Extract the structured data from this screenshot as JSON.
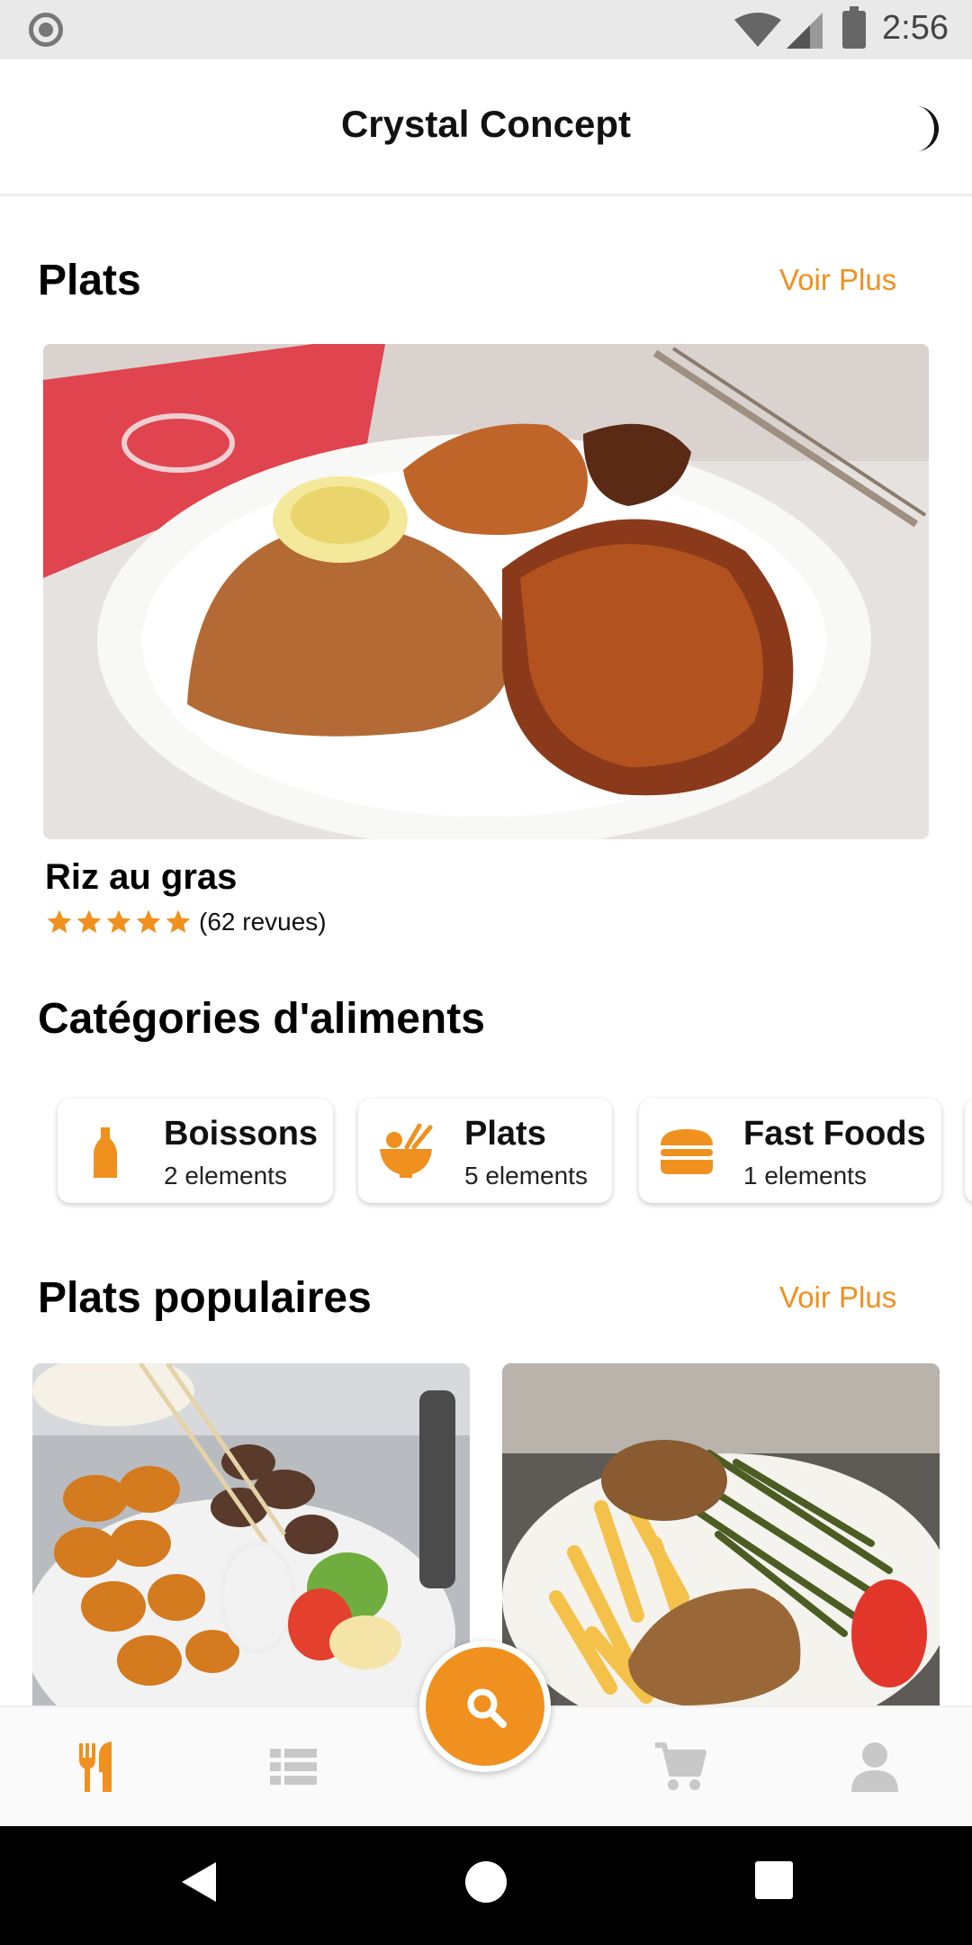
{
  "status_bar": {
    "time": "2:56",
    "icons": [
      "notification-icon",
      "wifi-icon",
      "cellular-icon",
      "battery-icon"
    ]
  },
  "header": {
    "title": "Crystal Concept",
    "theme_icon": "moon-icon"
  },
  "featured": {
    "section_title": "Plats",
    "see_more": "Voir Plus",
    "item": {
      "name": "Riz au gras",
      "rating": 5,
      "reviews": "(62 revues)"
    }
  },
  "categories": {
    "section_title": "Catégories d'aliments",
    "items": [
      {
        "name": "Boissons",
        "count": "2 elements",
        "icon": "bottle-icon"
      },
      {
        "name": "Plats",
        "count": "5 elements",
        "icon": "bowl-icon"
      },
      {
        "name": "Fast Foods",
        "count": "1 elements",
        "icon": "burger-icon"
      }
    ]
  },
  "popular": {
    "section_title": "Plats populaires",
    "see_more": "Voir Plus"
  },
  "bottom_nav": {
    "items": [
      {
        "icon": "utensils-icon",
        "active": true
      },
      {
        "icon": "list-icon",
        "active": false
      },
      {
        "icon": "search-icon",
        "active": false
      },
      {
        "icon": "cart-icon",
        "active": false
      },
      {
        "icon": "user-icon",
        "active": false
      }
    ]
  },
  "colors": {
    "accent": "#f0901e",
    "inactive": "#c8c8c8",
    "text": "#111111"
  }
}
